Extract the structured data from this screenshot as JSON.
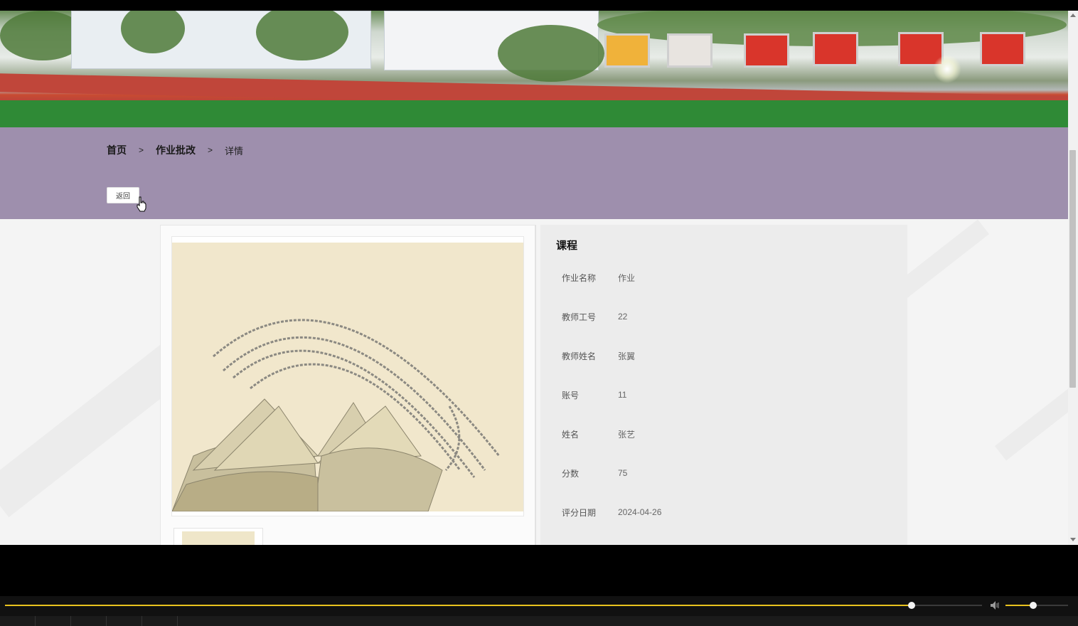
{
  "breadcrumb": {
    "home": "首页",
    "section": "作业批改",
    "current": "详情",
    "separator": ">"
  },
  "back_button": "返回",
  "detail": {
    "title": "课程",
    "fields": [
      {
        "label": "作业名称",
        "value": "作业"
      },
      {
        "label": "教师工号",
        "value": "22"
      },
      {
        "label": "教师姓名",
        "value": "张翼"
      },
      {
        "label": "账号",
        "value": "11"
      },
      {
        "label": "姓名",
        "value": "张艺"
      },
      {
        "label": "分数",
        "value": "75"
      },
      {
        "label": "评分日期",
        "value": "2024-04-26"
      }
    ]
  },
  "media_player": {
    "progress_fraction": 0.928,
    "volume_fraction": 0.44
  },
  "colors": {
    "header_band": "#9e8fad",
    "accent": "#e8c21e"
  },
  "icons": {
    "cursor": "hand-pointer-icon",
    "volume": "speaker-icon"
  }
}
